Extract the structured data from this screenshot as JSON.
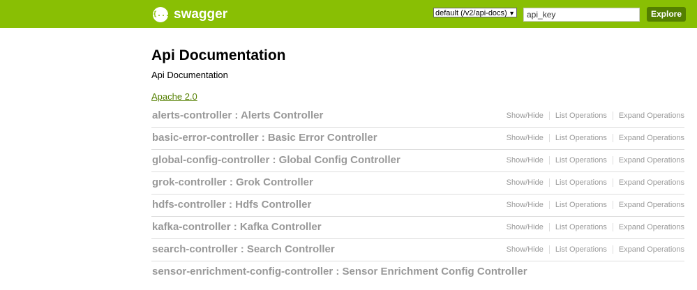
{
  "header": {
    "logo_text": "swagger",
    "logo_icon": "{...}",
    "spec_select": {
      "value": "default (/v2/api-docs)",
      "arrow": "▼"
    },
    "api_key": {
      "value": "api_key"
    },
    "explore_label": "Explore",
    "bg_color": "#89bf04"
  },
  "info": {
    "title": "Api Documentation",
    "description": "Api Documentation",
    "license": "Apache 2.0"
  },
  "resources": [
    {
      "name": "alerts-controller : Alerts Controller",
      "show_hide": "Show/Hide",
      "list_ops": "List Operations",
      "expand_ops": "Expand Operations"
    },
    {
      "name": "basic-error-controller : Basic Error Controller",
      "show_hide": "Show/Hide",
      "list_ops": "List Operations",
      "expand_ops": "Expand Operations"
    },
    {
      "name": "global-config-controller : Global Config Controller",
      "show_hide": "Show/Hide",
      "list_ops": "List Operations",
      "expand_ops": "Expand Operations"
    },
    {
      "name": "grok-controller : Grok Controller",
      "show_hide": "Show/Hide",
      "list_ops": "List Operations",
      "expand_ops": "Expand Operations"
    },
    {
      "name": "hdfs-controller : Hdfs Controller",
      "show_hide": "Show/Hide",
      "list_ops": "List Operations",
      "expand_ops": "Expand Operations"
    },
    {
      "name": "kafka-controller : Kafka Controller",
      "show_hide": "Show/Hide",
      "list_ops": "List Operations",
      "expand_ops": "Expand Operations"
    },
    {
      "name": "search-controller : Search Controller",
      "show_hide": "Show/Hide",
      "list_ops": "List Operations",
      "expand_ops": "Expand Operations"
    },
    {
      "name": "sensor-enrichment-config-controller : Sensor Enrichment Config Controller"
    }
  ]
}
